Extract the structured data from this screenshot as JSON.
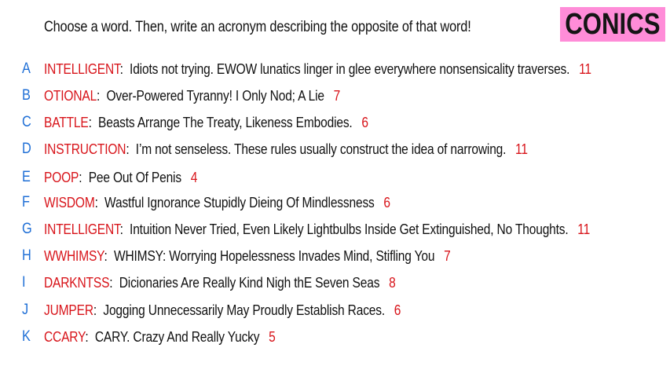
{
  "prompt": "Choose a word. Then, write an acronym describing the opposite of that word!",
  "logo": {
    "text": "CONICS",
    "bg_color": "#ff8cd8"
  },
  "colors": {
    "letter": "#1f6fd6",
    "word": "#d8141a",
    "score": "#d8141a",
    "text": "#111111"
  },
  "entries": [
    {
      "letter": "A",
      "word": "INTELLIGENT",
      "text": "Idiots not trying. EWOW lunatics linger in glee everywhere nonsensicality traverses.",
      "score": "11"
    },
    {
      "letter": "B",
      "word": "OTIONAL",
      "text": "Over-Powered Tyranny! I Only Nod; A Lie",
      "score": "7"
    },
    {
      "letter": "C",
      "word": "BATTLE",
      "text": "Beasts Arrange The Treaty, Likeness Embodies.",
      "score": "6"
    },
    {
      "letter": "D",
      "word": "INSTRUCTION",
      "text": "I’m not senseless. These rules usually construct the idea of narrowing.",
      "score": "11"
    },
    {
      "letter": "E",
      "word": "POOP",
      "text": "Pee Out Of Penis",
      "score": "4"
    },
    {
      "letter": "F",
      "word": "WISDOM",
      "text": "Wastful Ignorance Stupidly Dieing Of Mindlessness",
      "score": "6"
    },
    {
      "letter": "G",
      "word": "INTELLIGENT",
      "text": "Intuition Never Tried, Even Likely Lightbulbs Inside Get Extinguished, No Thoughts.",
      "score": "11"
    },
    {
      "letter": "H",
      "word": "WWHIMSY",
      "text": "WHIMSY: Worrying Hopelessness Invades Mind, Stifling You",
      "score": "7"
    },
    {
      "letter": "I",
      "word": "DARKNTSS",
      "text": "Dicionaries Are Really Kind Nigh thE Seven Seas",
      "score": "8"
    },
    {
      "letter": "J",
      "word": "JUMPER",
      "text": "Jogging Unnecessarily May Proudly Establish Races.",
      "score": "6"
    },
    {
      "letter": "K",
      "word": "CCARY",
      "text": "CARY. Crazy And Really Yucky",
      "score": "5"
    }
  ]
}
